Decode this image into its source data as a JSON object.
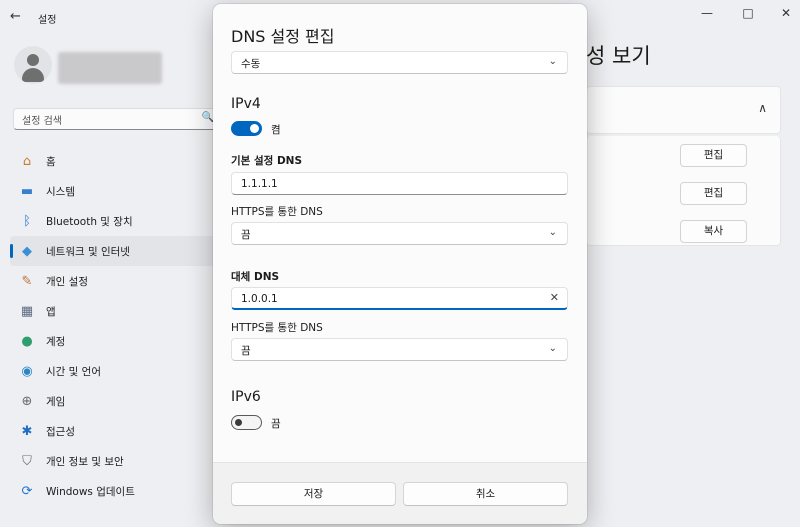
{
  "window": {
    "title": "설정",
    "back_icon": "←",
    "minimize_icon": "—",
    "maximize_icon": "□",
    "close_icon": "✕"
  },
  "search": {
    "placeholder": "설정 검색",
    "icon": "🔍"
  },
  "nav": {
    "items": [
      {
        "label": "홈",
        "icon": "home-icon",
        "glyph": "⌂",
        "color": "#c87a2e"
      },
      {
        "label": "시스템",
        "icon": "monitor-icon",
        "glyph": "▬",
        "color": "#3a7fcf"
      },
      {
        "label": "Bluetooth 및 장치",
        "icon": "bluetooth-icon",
        "glyph": "ᛒ",
        "color": "#1f74d0"
      },
      {
        "label": "네트워크 및 인터넷",
        "icon": "wifi-icon",
        "glyph": "◆",
        "color": "#3b8fd6",
        "active": true
      },
      {
        "label": "개인 설정",
        "icon": "brush-icon",
        "glyph": "✎",
        "color": "#c0703a"
      },
      {
        "label": "앱",
        "icon": "apps-icon",
        "glyph": "▦",
        "color": "#5b6b80"
      },
      {
        "label": "계정",
        "icon": "account-icon",
        "glyph": "●",
        "color": "#2f9e6e"
      },
      {
        "label": "시간 및 언어",
        "icon": "globe-icon",
        "glyph": "◉",
        "color": "#2a86c4"
      },
      {
        "label": "게임",
        "icon": "gamepad-icon",
        "glyph": "⊕",
        "color": "#6a6a6a"
      },
      {
        "label": "접근성",
        "icon": "accessibility-icon",
        "glyph": "✱",
        "color": "#1d6fc4"
      },
      {
        "label": "개인 정보 및 보안",
        "icon": "shield-icon",
        "glyph": "⛉",
        "color": "#6b6b6b"
      },
      {
        "label": "Windows 업데이트",
        "icon": "update-icon",
        "glyph": "⟳",
        "color": "#1f74d0"
      }
    ]
  },
  "background": {
    "page_title_partial": "성 보기",
    "chevron_up": "∧",
    "buttons": [
      "편집",
      "편집",
      "복사"
    ]
  },
  "dialog": {
    "title": "DNS 설정 편집",
    "mode_value": "수동",
    "chevron": "⌄",
    "ipv4": {
      "heading": "IPv4",
      "toggle_state": "켬",
      "preferred_label": "기본 설정 DNS",
      "preferred_value": "1.1.1.1",
      "preferred_https_label": "HTTPS를 통한 DNS",
      "preferred_https_value": "끔",
      "alternate_label": "대체 DNS",
      "alternate_value": "1.0.0.1",
      "alternate_https_label": "HTTPS를 통한 DNS",
      "alternate_https_value": "끔",
      "clear_icon": "✕"
    },
    "ipv6": {
      "heading": "IPv6",
      "toggle_state": "끔"
    },
    "save_label": "저장",
    "cancel_label": "취소"
  },
  "colors": {
    "accent": "#0067c0"
  }
}
